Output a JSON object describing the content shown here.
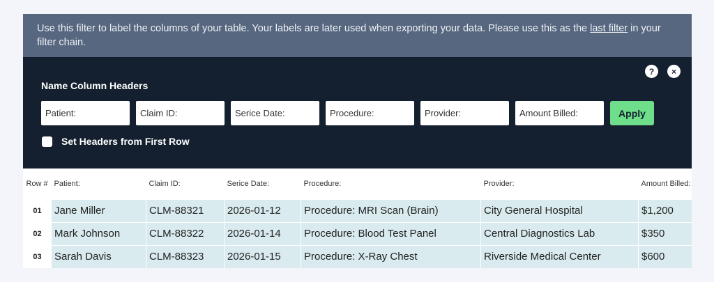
{
  "info": {
    "text_before": "Use this filter to label the columns of your table. Your labels are later used when exporting your data. Please use this as the ",
    "link": "last filter",
    "text_after": " in your filter chain."
  },
  "filter": {
    "title": "Name Column Headers",
    "help_glyph": "?",
    "close_glyph": "×",
    "inputs": [
      "Patient:",
      "Claim ID:",
      "Serice Date:",
      "Procedure:",
      "Provider:",
      "Amount Billed:"
    ],
    "apply_label": "Apply",
    "checkbox_label": "Set Headers from First Row"
  },
  "table": {
    "headers": [
      "Row #",
      "Patient:",
      "Claim ID:",
      "Serice Date:",
      "Procedure:",
      "Provider:",
      "Amount Billed:"
    ],
    "rows": [
      [
        "01",
        "Jane Miller",
        "CLM-88321",
        "2026-01-12",
        "Procedure: MRI Scan (Brain)",
        "City General Hospital",
        "$1,200"
      ],
      [
        "02",
        "Mark Johnson",
        "CLM-88322",
        "2026-01-14",
        "Procedure: Blood Test Panel",
        "Central Diagnostics Lab",
        "$350"
      ],
      [
        "03",
        "Sarah Davis",
        "CLM-88323",
        "2026-01-15",
        "Procedure: X-Ray Chest",
        "Riverside Medical Center",
        "$600"
      ]
    ]
  },
  "colors": {
    "info_bar": "#57677f",
    "filter_bg": "#14202f",
    "apply": "#6fde8a",
    "row_bg": "#d9ebee"
  }
}
